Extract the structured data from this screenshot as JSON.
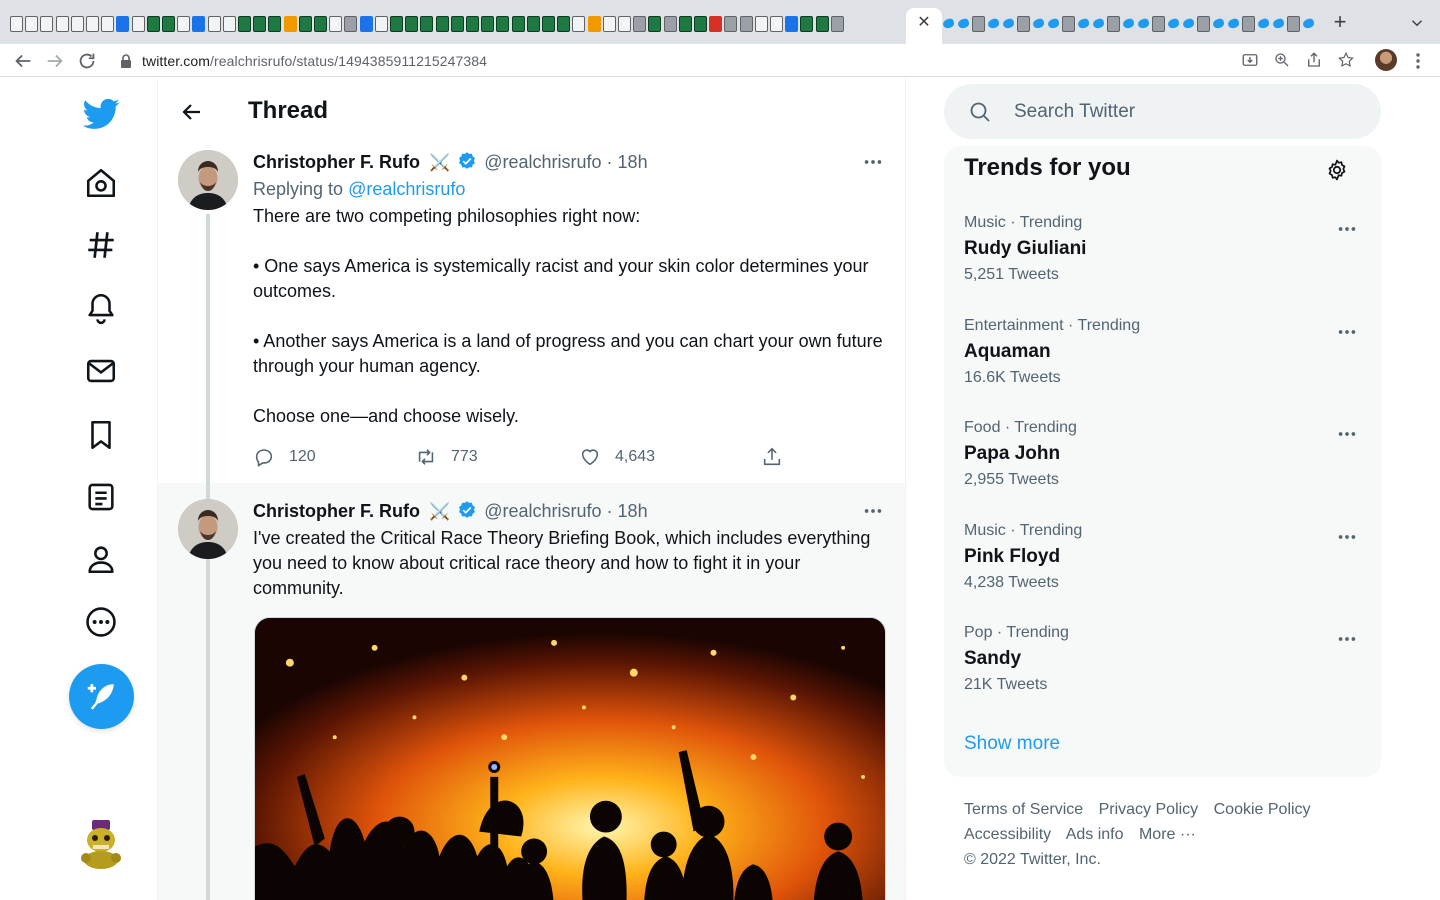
{
  "browser": {
    "url_host": "twitter.com",
    "url_path": "/realchrisrufo/status/1494385911215247384"
  },
  "header": {
    "title": "Thread"
  },
  "tweets": [
    {
      "name": "Christopher F. Rufo",
      "badge_emoji": "⚔️",
      "handle": "@realchrisrufo",
      "time": "· 18h",
      "replying_prefix": "Replying to ",
      "replying_handle": "@realchrisrufo",
      "paragraphs": [
        "There are two competing philosophies right now:",
        "• One says America is systemically racist and your skin color determines your outcomes.",
        "• Another says America is a land of progress and you can chart your own future through your human agency.",
        "Choose one—and choose wisely."
      ],
      "replies": "120",
      "retweets": "773",
      "likes": "4,643"
    },
    {
      "name": "Christopher F. Rufo",
      "badge_emoji": "⚔️",
      "handle": "@realchrisrufo",
      "time": "· 18h",
      "paragraphs": [
        "I've created the Critical Race Theory Briefing Book, which includes everything you need to know about critical race theory and how to fight it in your community."
      ]
    }
  ],
  "search": {
    "placeholder": "Search Twitter"
  },
  "trends": {
    "title": "Trends for you",
    "items": [
      {
        "meta": "Music · Trending",
        "name": "Rudy Giuliani",
        "count": "5,251 Tweets"
      },
      {
        "meta": "Entertainment · Trending",
        "name": "Aquaman",
        "count": "16.6K Tweets"
      },
      {
        "meta": "Food · Trending",
        "name": "Papa John",
        "count": "2,955 Tweets"
      },
      {
        "meta": "Music · Trending",
        "name": "Pink Floyd",
        "count": "4,238 Tweets"
      },
      {
        "meta": "Pop · Trending",
        "name": "Sandy",
        "count": "21K Tweets"
      }
    ],
    "show_more": "Show more"
  },
  "footer": {
    "links": [
      "Terms of Service",
      "Privacy Policy",
      "Cookie Policy",
      "Accessibility",
      "Ads info",
      "More ···"
    ],
    "copyright": "© 2022 Twitter, Inc."
  },
  "colors": {
    "accent": "#1d9bf0",
    "text_primary": "#0f1419",
    "text_secondary": "#536471"
  },
  "icons": [
    "twitter-logo-icon",
    "home-icon",
    "explore-icon",
    "notifications-icon",
    "messages-icon",
    "bookmarks-icon",
    "lists-icon",
    "profile-icon",
    "more-icon",
    "compose-icon",
    "back-arrow-icon",
    "reply-icon",
    "retweet-icon",
    "like-icon",
    "share-icon",
    "search-icon",
    "gear-icon"
  ]
}
